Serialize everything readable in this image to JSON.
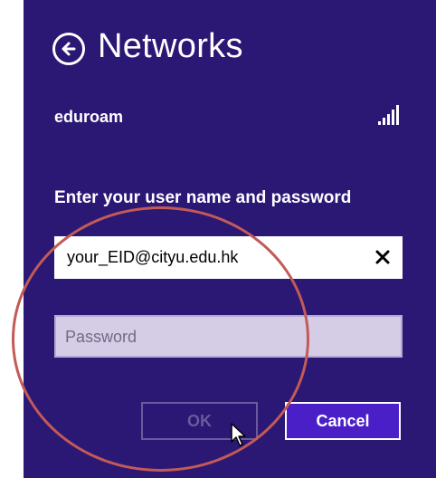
{
  "header": {
    "title": "Networks",
    "back_icon": "back-arrow-icon"
  },
  "network": {
    "name": "eduroam",
    "signal_icon": "wifi-signal-icon"
  },
  "form": {
    "prompt": "Enter your user name and password",
    "username": {
      "value": "your_EID@cityu.edu.hk",
      "clear_icon": "close-icon"
    },
    "password": {
      "placeholder": "Password",
      "value": ""
    }
  },
  "buttons": {
    "ok_label": "OK",
    "cancel_label": "Cancel"
  },
  "colors": {
    "panel_background": "#2b1774",
    "accent": "#4a1fc8",
    "annotation_circle": "#c25a57"
  }
}
